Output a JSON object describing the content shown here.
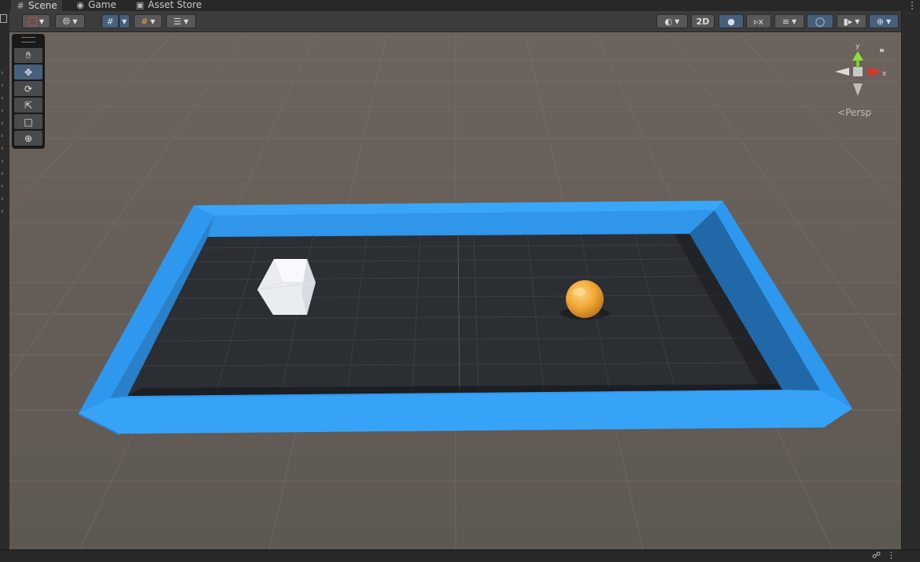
{
  "tabs": [
    {
      "label": "Scene",
      "icon": "grid-icon",
      "active": true
    },
    {
      "label": "Game",
      "icon": "gamepad-icon",
      "active": false
    },
    {
      "label": "Asset Store",
      "icon": "bag-icon",
      "active": false
    }
  ],
  "toolbar": {
    "twod_label": "2D"
  },
  "gizmo": {
    "persp_label": "Persp",
    "y_label": "y",
    "x_label": "x"
  },
  "colors": {
    "wall": "#2f9cf2",
    "floor": "#2a2d31",
    "ground": "#686059",
    "cube": "#f2f4f7",
    "sphere": "#f1a93a",
    "accent": "#46607c"
  }
}
